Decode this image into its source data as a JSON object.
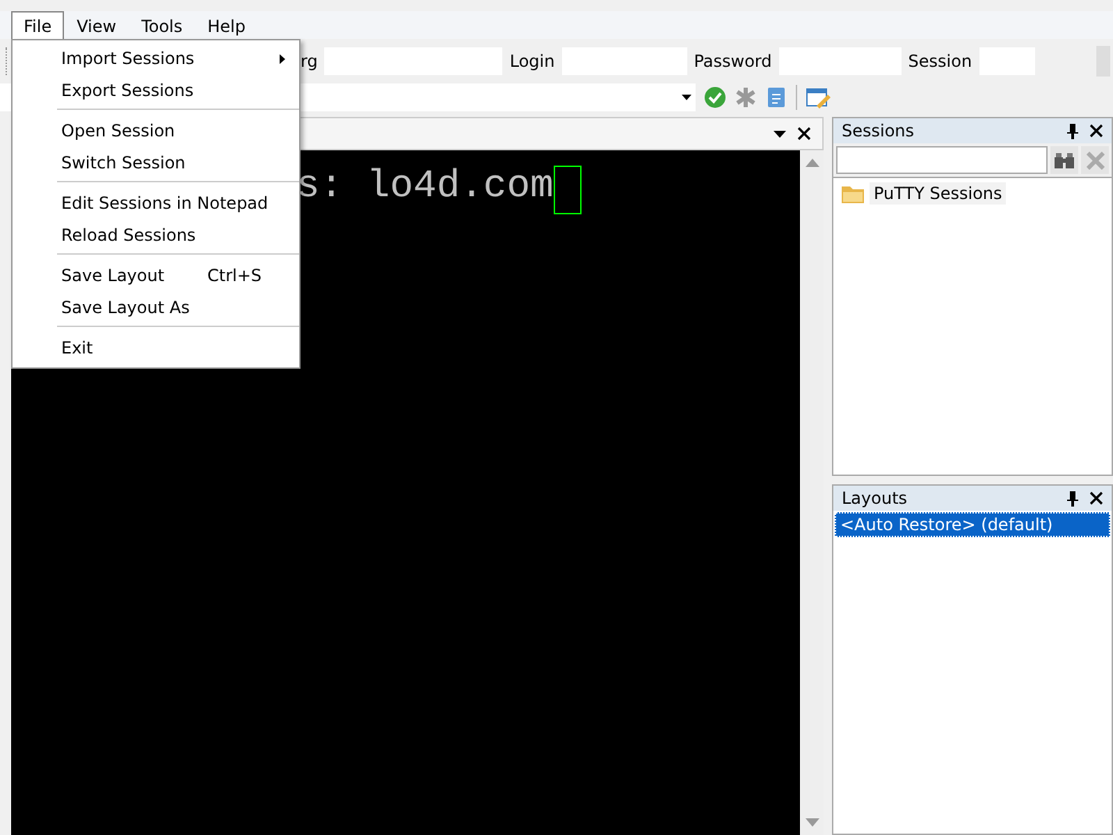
{
  "menu_bar": [
    {
      "label": "File",
      "selected": true
    },
    {
      "label": "View",
      "selected": false
    },
    {
      "label": "Tools",
      "selected": false
    },
    {
      "label": "Help",
      "selected": false
    }
  ],
  "file_menu": [
    {
      "label": "Import Sessions",
      "submenu": true
    },
    {
      "label": "Export Sessions",
      "submenu": false,
      "separator_after": true
    },
    {
      "label": "Open Session",
      "submenu": false
    },
    {
      "label": "Switch Session",
      "submenu": false,
      "separator_after": true
    },
    {
      "label": "Edit Sessions in Notepad",
      "submenu": false
    },
    {
      "label": "Reload Sessions",
      "submenu": false,
      "separator_after": true
    },
    {
      "label": "Save Layout",
      "shortcut": "Ctrl+S",
      "submenu": false
    },
    {
      "label": "Save Layout As",
      "submenu": false,
      "separator_after": true
    },
    {
      "label": "Exit",
      "submenu": false
    }
  ],
  "connection_bar": [
    {
      "label": "rg"
    },
    {
      "label": "Login"
    },
    {
      "label": "Password"
    },
    {
      "label": "Session"
    }
  ],
  "terminal": {
    "text": "s: lo4d.com"
  },
  "sessions_panel": {
    "title": "Sessions",
    "tree": [
      {
        "label": "PuTTY Sessions",
        "selected": false
      }
    ]
  },
  "layouts_panel": {
    "title": "Layouts",
    "items": [
      {
        "label": "<Auto Restore> (default)",
        "selected": true
      }
    ]
  }
}
